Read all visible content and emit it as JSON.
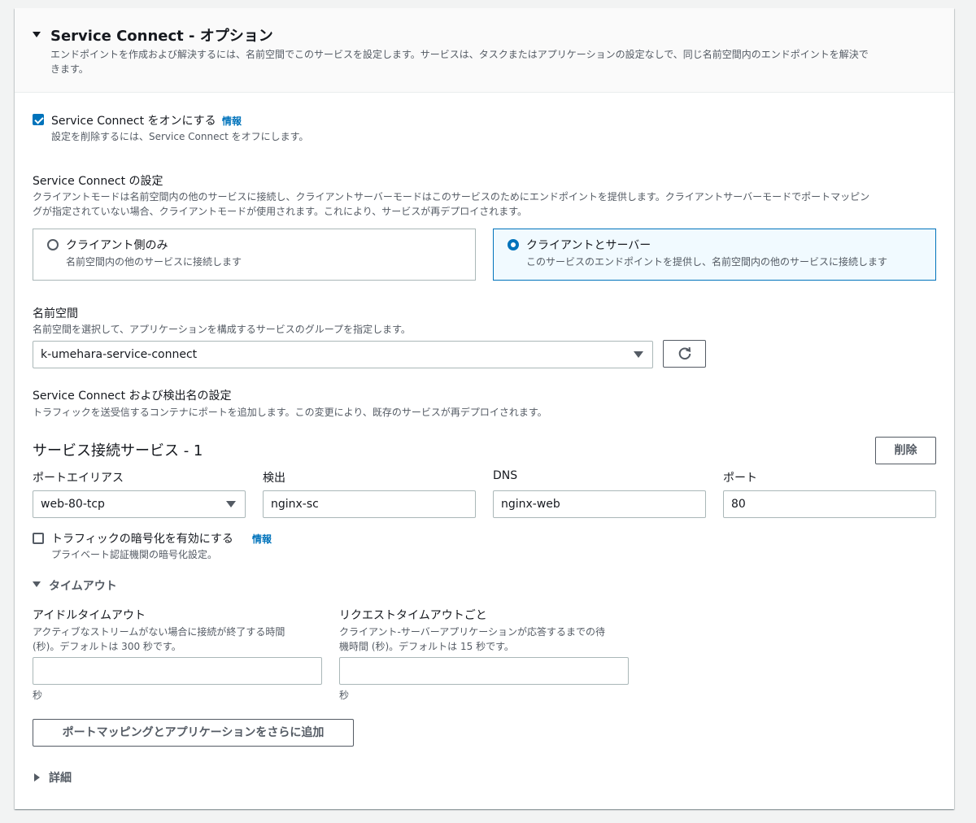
{
  "header": {
    "title": "Service Connect - オプション",
    "description": "エンドポイントを作成および解決するには、名前空間でこのサービスを設定します。サービスは、タスクまたはアプリケーションの設定なしで、同じ名前空間内のエンドポイントを解決で",
    "description_cont": "きます。"
  },
  "enable": {
    "label": "Service Connect をオンにする",
    "info": "情報",
    "description": "設定を削除するには、Service Connect をオフにします。",
    "checked": true
  },
  "config": {
    "label": "Service Connect の設定",
    "description_line1": "クライアントモードは名前空間内の他のサービスに接続し、クライアントサーバーモードはこのサービスのためにエンドポイントを提供します。クライアントサーバーモードでポートマッピン",
    "description_line2": "グが指定されていない場合、クライアントモードが使用されます。これにより、サービスが再デプロイされます。",
    "options": [
      {
        "title": "クライアント側のみ",
        "description": "名前空間内の他のサービスに接続します",
        "selected": false
      },
      {
        "title": "クライアントとサーバー",
        "description": "このサービスのエンドポイントを提供し、名前空間内の他のサービスに接続します",
        "selected": true
      }
    ]
  },
  "namespace": {
    "label": "名前空間",
    "description": "名前空間を選択して、アプリケーションを構成するサービスのグループを指定します。",
    "value": "k-umehara-service-connect",
    "refresh_icon": "refresh-icon"
  },
  "discovery": {
    "label": "Service Connect および検出名の設定",
    "description": "トラフィックを送受信するコンテナにポートを追加します。この変更により、既存のサービスが再デプロイされます。"
  },
  "service": {
    "title": "サービス接続サービス - 1",
    "remove_label": "削除",
    "fields": {
      "port_alias": {
        "label": "ポートエイリアス",
        "value": "web-80-tcp"
      },
      "discovery": {
        "label": "検出",
        "value": "nginx-sc"
      },
      "dns": {
        "label": "DNS",
        "value": "nginx-web"
      },
      "port": {
        "label": "ポート",
        "value": "80"
      }
    },
    "encryption": {
      "label": "トラフィックの暗号化を有効にする",
      "info": "情報",
      "description": "プライベート認証機関の暗号化設定。",
      "checked": false
    },
    "timeout": {
      "label": "タイムアウト",
      "idle": {
        "label": "アイドルタイムアウト",
        "description_line1": "アクティブなストリームがない場合に接続が終了する時間",
        "description_line2": "(秒)。デフォルトは 300 秒です。",
        "value": "",
        "unit": "秒"
      },
      "per_request": {
        "label": "リクエストタイムアウトごと",
        "description_line1": "クライアント-サーバーアプリケーションが応答するまでの待",
        "description_line2": "機時間 (秒)。デフォルトは 15 秒です。",
        "value": "",
        "unit": "秒"
      }
    }
  },
  "add_button_label": "ポートマッピングとアプリケーションをさらに追加",
  "details_label": "詳細",
  "colors": {
    "accent": "#0073bb",
    "selected_tile_bg": "#f1faff",
    "border": "#aab7b8",
    "text": "#16191f",
    "secondary_text": "#545b64"
  }
}
